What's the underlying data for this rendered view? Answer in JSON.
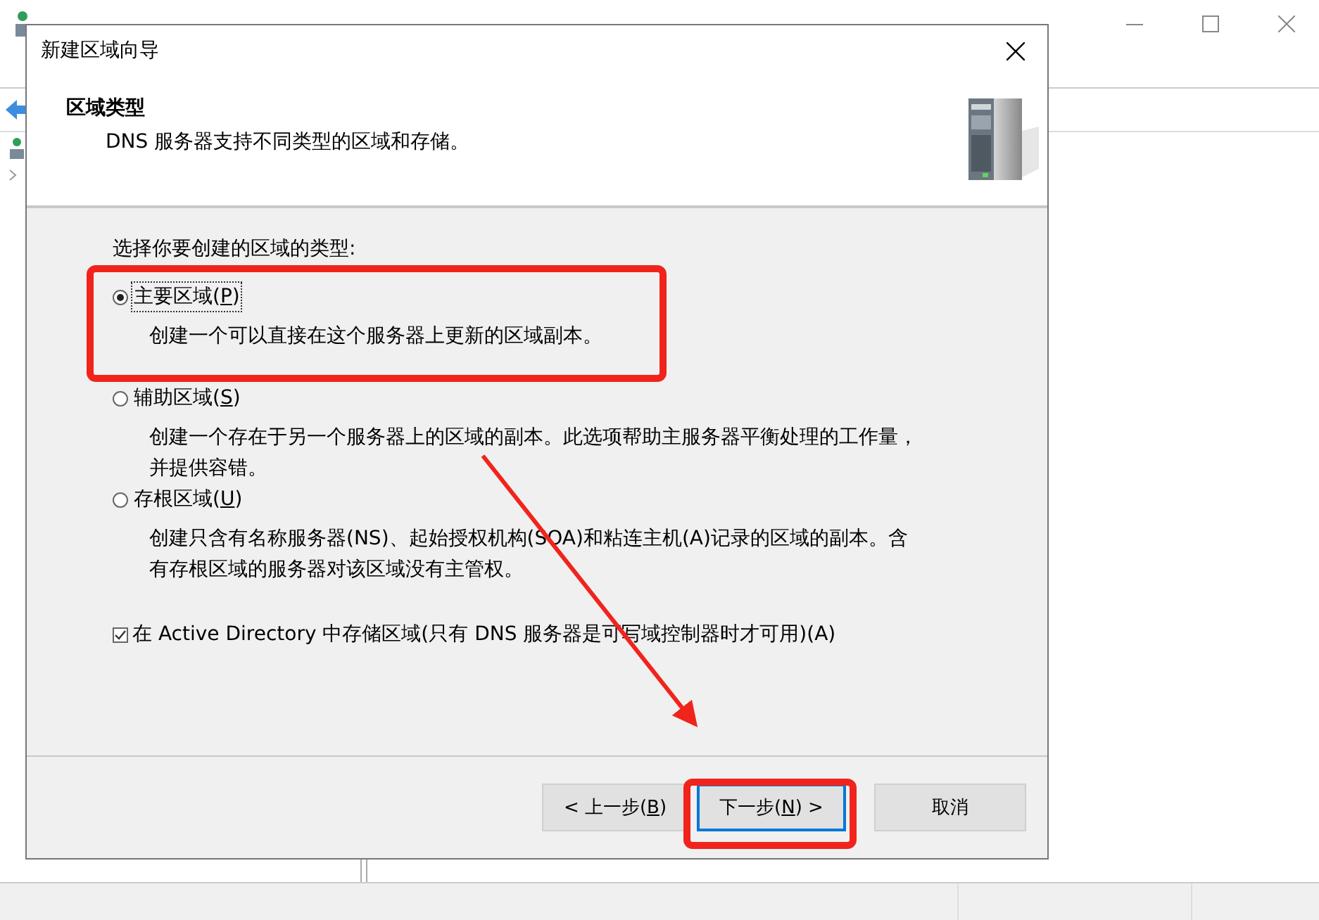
{
  "dialog": {
    "title": "新建区域向导",
    "header": {
      "title": "区域类型",
      "subtitle": "DNS 服务器支持不同类型的区域和存储。"
    },
    "prompt": "选择你要创建的区域的类型:",
    "options": [
      {
        "text": "主要区域(",
        "access_key": "P",
        "text_after": ")",
        "description": "创建一个可以直接在这个服务器上更新的区域副本。",
        "selected": true,
        "focused": true
      },
      {
        "text": "辅助区域(",
        "access_key": "S",
        "text_after": ")",
        "description": "创建一个存在于另一个服务器上的区域的副本。此选项帮助主服务器平衡处理的工作量，并提供容错。",
        "selected": false,
        "focused": false
      },
      {
        "text": "存根区域(",
        "access_key": "U",
        "text_after": ")",
        "description": "创建只含有名称服务器(NS)、起始授权机构(SOA)和粘连主机(A)记录的区域的副本。含有存根区域的服务器对该区域没有主管权。",
        "selected": false,
        "focused": false
      }
    ],
    "checkbox": {
      "text": "在 Active Directory 中存储区域(只有 DNS 服务器是可写域控制器时才可用)(A)",
      "checked": true
    },
    "buttons": [
      {
        "text": "< 上一步(",
        "access_key": "B",
        "text_after": ")",
        "default": false
      },
      {
        "text": "下一步(",
        "access_key": "N",
        "text_after": ") >",
        "default": true
      },
      {
        "text": "取消",
        "default": false
      }
    ]
  }
}
